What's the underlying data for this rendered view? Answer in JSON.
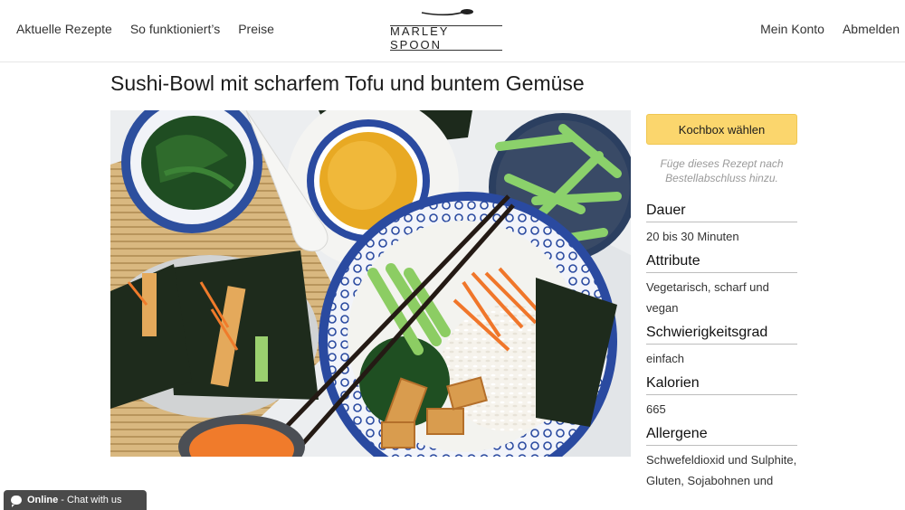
{
  "nav": {
    "left": [
      "Aktuelle Rezepte",
      "So funktioniert’s",
      "Preise"
    ],
    "right": [
      "Mein Konto",
      "Abmelden"
    ],
    "logo_text": "MARLEY SPOON"
  },
  "recipe": {
    "title": "Sushi-Bowl mit scharfem Tofu und buntem Gemüse",
    "image_alt": "sushi-bowl-photo"
  },
  "sidebar": {
    "button_label": "Kochbox wählen",
    "hint": "Füge dieses Rezept nach Bestellabschluss hinzu.",
    "attributes": [
      {
        "heading": "Dauer",
        "value": "20 bis 30 Minuten"
      },
      {
        "heading": "Attribute",
        "value": "Vegetarisch, scharf und vegan"
      },
      {
        "heading": "Schwierigkeitsgrad",
        "value": "einfach"
      },
      {
        "heading": "Kalorien",
        "value": "665"
      },
      {
        "heading": "Allergene",
        "value": "Schwefeldioxid und Sulphite, Gluten, Sojabohnen und"
      }
    ]
  },
  "chat": {
    "status": "Online",
    "label": "- Chat with us"
  },
  "colors": {
    "button": "#fbd66d",
    "chat_bg": "#4a4a4a"
  }
}
